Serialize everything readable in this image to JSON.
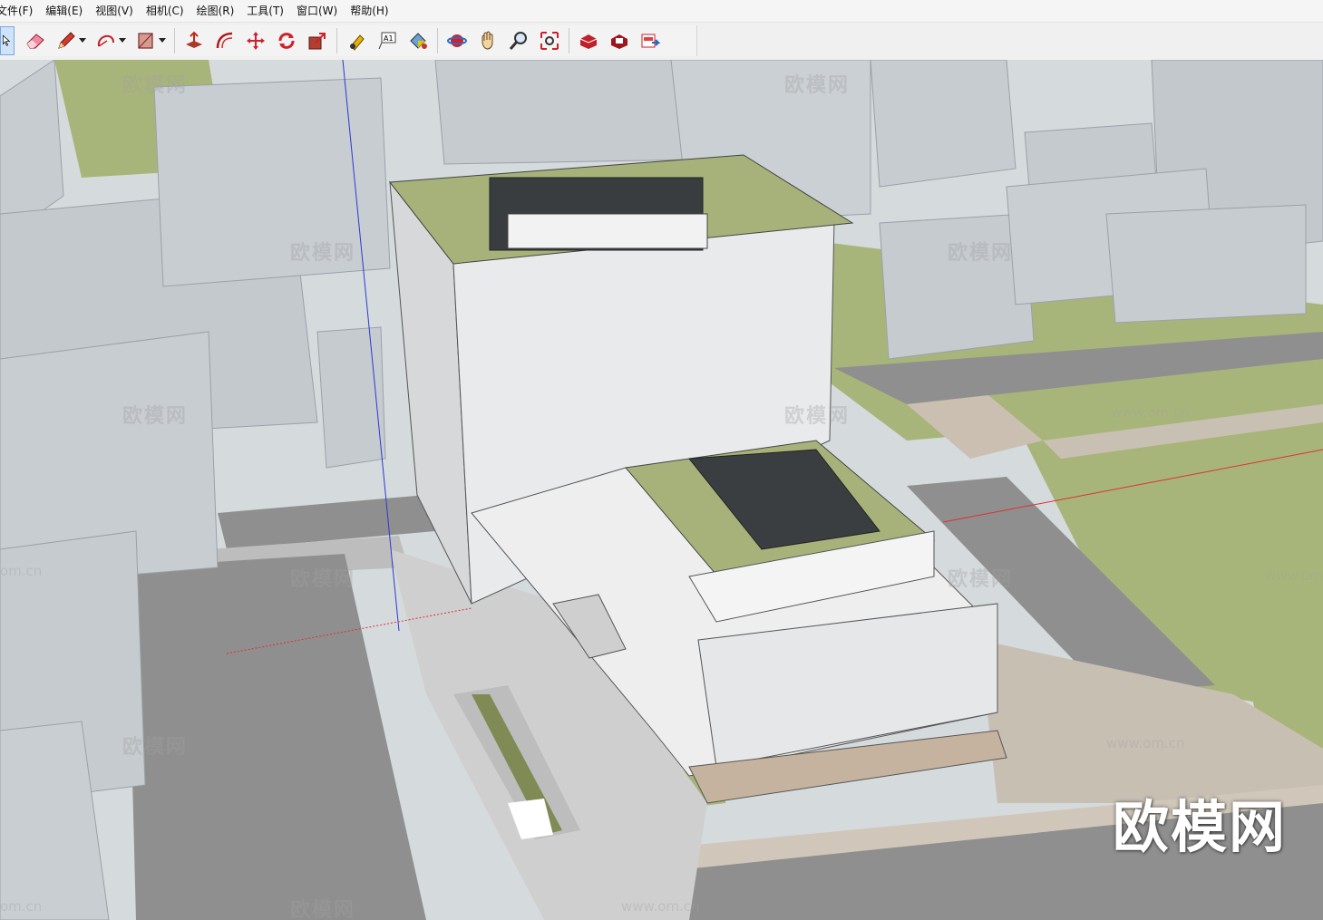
{
  "menu": [
    "文件(F)",
    "编辑(E)",
    "视图(V)",
    "相机(C)",
    "绘图(R)",
    "工具(T)",
    "窗口(W)",
    "帮助(H)"
  ],
  "toolbar": {
    "tools": [
      {
        "name": "select-icon"
      },
      {
        "name": "eraser-icon"
      },
      {
        "name": "pencil-icon",
        "dropdown": true
      },
      {
        "name": "arc-icon",
        "dropdown": true
      },
      {
        "name": "rectangle-icon",
        "dropdown": true
      },
      {
        "name": "push-pull-icon"
      },
      {
        "name": "offset-icon"
      },
      {
        "name": "move-icon"
      },
      {
        "name": "rotate-icon"
      },
      {
        "name": "scale-icon"
      },
      {
        "name": "tape-measure-icon"
      },
      {
        "name": "text-icon"
      },
      {
        "name": "paint-bucket-icon"
      },
      {
        "name": "orbit-icon"
      },
      {
        "name": "pan-icon"
      },
      {
        "name": "zoom-icon"
      },
      {
        "name": "zoom-extents-icon"
      },
      {
        "name": "warehouse-icon"
      },
      {
        "name": "extension-warehouse-icon"
      },
      {
        "name": "send-to-layout-icon"
      }
    ]
  },
  "watermarks": [
    "欧模网",
    "欧模网",
    "欧模网",
    "欧模网",
    "欧模网",
    "欧模网",
    "欧模网",
    "欧模网",
    "欧模网",
    "欧模网"
  ],
  "watermarks_url": [
    "www.om.cn",
    "www.om.cn",
    "www.om.cn",
    "om.cn",
    "om.cn",
    "www.om.cn"
  ],
  "brand": "欧模网",
  "colors": {
    "lawn": "#a8b57a",
    "road": "#9a9a9a",
    "paving": "#cfcfcf",
    "context_blocks": "#c4cad0",
    "building": "#e8e8e8"
  }
}
